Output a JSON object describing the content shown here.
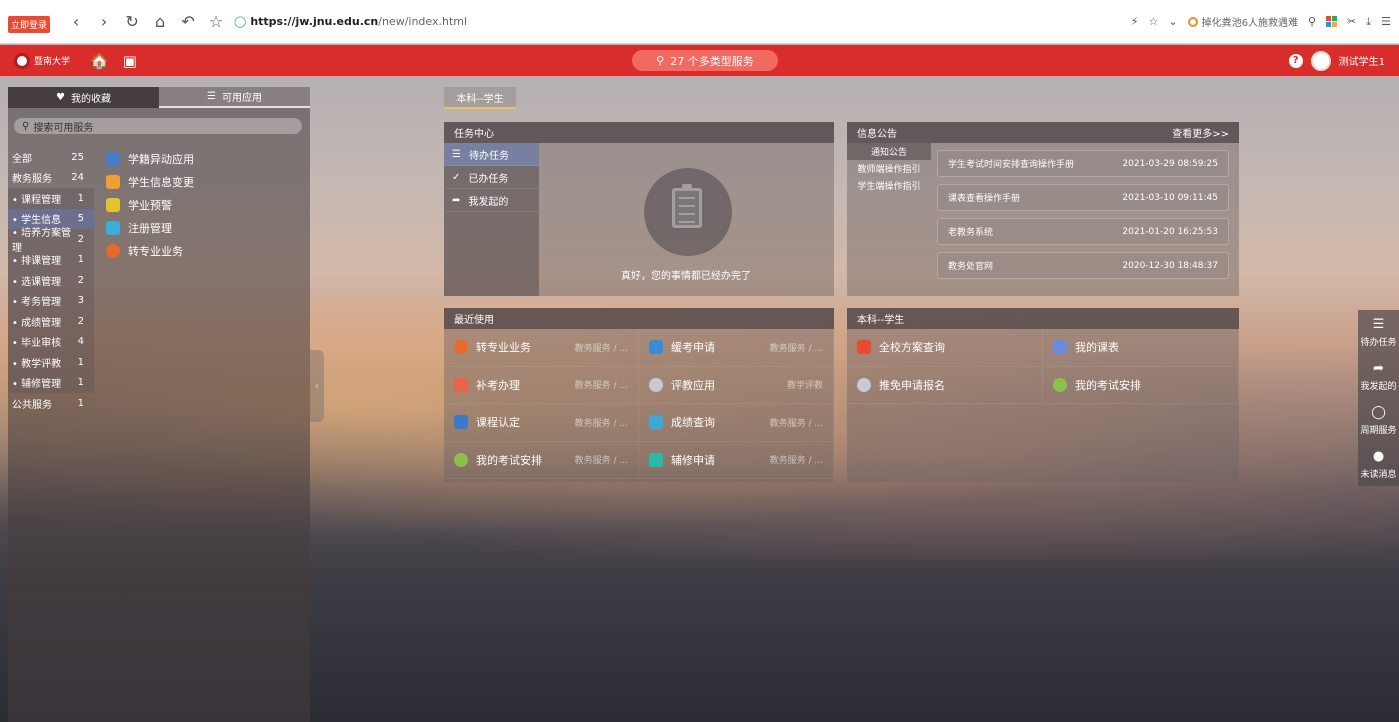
{
  "browser": {
    "promo": "立即登录",
    "url_host": "https://jw.jnu.edu.cn",
    "url_path": "/new/index.html",
    "hot_search": "掉化粪池6人施救遇难"
  },
  "header": {
    "logo_text": "暨南大学",
    "search_label": "27 个多类型服务",
    "user": "测试学生1"
  },
  "left_panel": {
    "tabs": [
      "我的收藏",
      "可用应用"
    ],
    "search_placeholder": "搜索可用服务",
    "categories": [
      {
        "name": "全部",
        "count": "25"
      },
      {
        "name": "教务服务",
        "count": "24"
      },
      {
        "name": "• 课程管理",
        "count": "1"
      },
      {
        "name": "• 学生信息",
        "count": "5"
      },
      {
        "name": "• 培养方案管理",
        "count": "2"
      },
      {
        "name": "• 排课管理",
        "count": "1"
      },
      {
        "name": "• 选课管理",
        "count": "2"
      },
      {
        "name": "• 考务管理",
        "count": "3"
      },
      {
        "name": "• 成绩管理",
        "count": "2"
      },
      {
        "name": "• 毕业审核",
        "count": "4"
      },
      {
        "name": "• 教学评教",
        "count": "1"
      },
      {
        "name": "• 辅修管理",
        "count": "1"
      },
      {
        "name": "公共服务",
        "count": "1"
      }
    ],
    "apps": [
      "学籍异动应用",
      "学生信息变更",
      "学业预警",
      "注册管理",
      "转专业业务"
    ]
  },
  "role_tab": "本科--学生",
  "task_center": {
    "title": "任务中心",
    "items": [
      "待办任务",
      "已办任务",
      "我发起的"
    ],
    "empty_text": "真好，您的事情都已经办完了"
  },
  "notices": {
    "title": "信息公告",
    "more": "查看更多>>",
    "categories": [
      "通知公告",
      "教师端操作指引",
      "学生端操作指引"
    ],
    "items": [
      {
        "title": "学生考试时间安排查询操作手册",
        "date": "2021-03-29 08:59:25"
      },
      {
        "title": "课表查看操作手册",
        "date": "2021-03-10 09:11:45"
      },
      {
        "title": "老教务系统",
        "date": "2021-01-20 16:25:53"
      },
      {
        "title": "教务处官网",
        "date": "2020-12-30 18:48:37"
      }
    ]
  },
  "recent": {
    "title": "最近使用",
    "items": [
      {
        "name": "转专业业务",
        "cat": "教务服务 / ..."
      },
      {
        "name": "缓考申请",
        "cat": "教务服务 / ..."
      },
      {
        "name": "补考办理",
        "cat": "教务服务 / ..."
      },
      {
        "name": "评教应用",
        "cat": "教学评教"
      },
      {
        "name": "课程认定",
        "cat": "教务服务 / ..."
      },
      {
        "name": "成绩查询",
        "cat": "教务服务 / ..."
      },
      {
        "name": "我的考试安排",
        "cat": "教务服务 / ..."
      },
      {
        "name": "辅修申请",
        "cat": "教务服务 / ..."
      }
    ]
  },
  "role_panel": {
    "title": "本科--学生",
    "items": [
      "全校方案查询",
      "我的课表",
      "推免申请报名",
      "我的考试安排"
    ]
  },
  "dock": [
    "待办任务",
    "我发起的",
    "周期服务",
    "未读消息"
  ],
  "colors": {
    "header_red": "#d92d2b",
    "active_blue": "#7b8cc0"
  }
}
